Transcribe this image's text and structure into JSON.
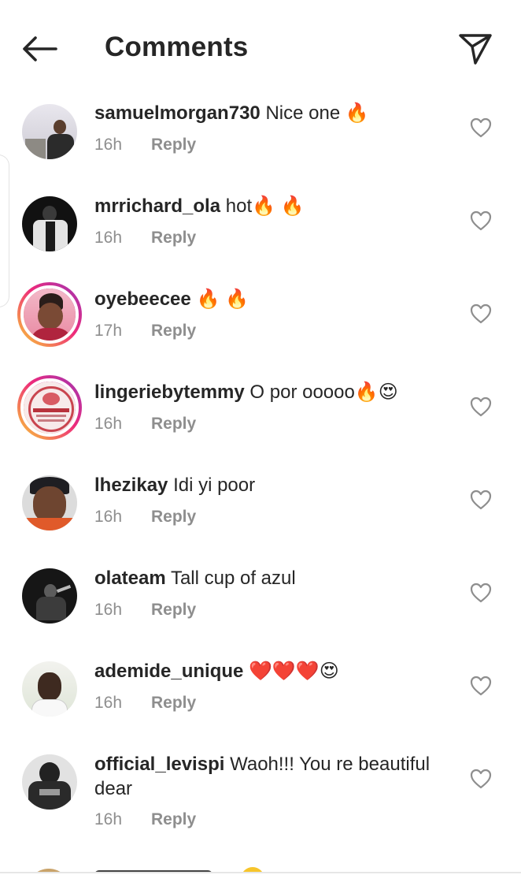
{
  "header": {
    "title": "Comments"
  },
  "comments": [
    {
      "username": "samuelmorgan730",
      "text": "Nice one 🔥",
      "time": "16h",
      "reply": "Reply"
    },
    {
      "username": "mrrichard_ola",
      "text": "hot🔥 🔥",
      "time": "16h",
      "reply": "Reply"
    },
    {
      "username": "oyebeecee",
      "text": "🔥 🔥",
      "time": "17h",
      "reply": "Reply"
    },
    {
      "username": "lingeriebytemmy",
      "text": "O por ooooo🔥😍",
      "time": "16h",
      "reply": "Reply"
    },
    {
      "username": "lhezikay",
      "text": "Idi yi poor",
      "time": "16h",
      "reply": "Reply"
    },
    {
      "username": "olateam",
      "text": "Tall cup of azul",
      "time": "16h",
      "reply": "Reply"
    },
    {
      "username": "ademide_unique",
      "text": "❤️❤️❤️😍",
      "time": "16h",
      "reply": "Reply"
    },
    {
      "username": "official_levispi",
      "text": "Waoh!!! You re beautiful dear",
      "time": "16h",
      "reply": "Reply"
    }
  ],
  "icons": {
    "back": "arrow-left-icon",
    "share": "paper-plane-icon",
    "like": "heart-outline-icon"
  },
  "colors": {
    "text": "#262626",
    "secondary": "#8e8e8e",
    "story_ring_start": "#f9ce34",
    "story_ring_end": "#ee2a7b"
  }
}
